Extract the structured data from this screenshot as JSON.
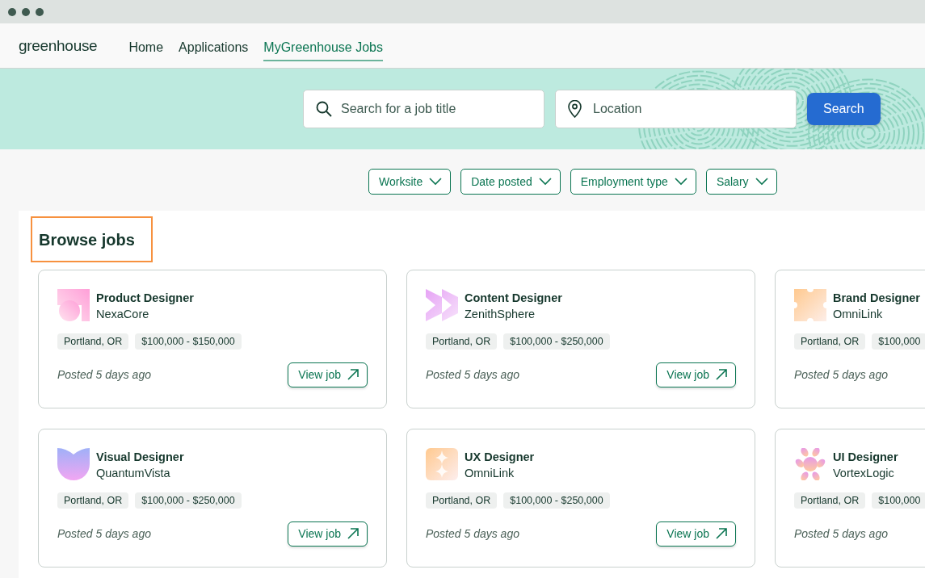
{
  "brand": "greenhouse",
  "nav": [
    {
      "label": "Home",
      "selected": false
    },
    {
      "label": "Applications",
      "selected": false
    },
    {
      "label": "MyGreenhouse Jobs",
      "selected": true
    }
  ],
  "search": {
    "job_placeholder": "Search for a job title",
    "location_placeholder": "Location",
    "button": "Search"
  },
  "filters": [
    "Worksite",
    "Date posted",
    "Employment type",
    "Salary"
  ],
  "section": {
    "title": "Browse jobs",
    "highlighted": true
  },
  "jobs": [
    {
      "kind": "square-circle",
      "title": "Product Designer",
      "company": "NexaCore",
      "tags": [
        "Portland, OR",
        "$100,000 - $150,000"
      ],
      "posted": "Posted 5 days ago",
      "button": "View job"
    },
    {
      "kind": "chevrons",
      "title": "Content Designer",
      "company": "ZenithSphere",
      "tags": [
        "Portland, OR",
        "$100,000 - $250,000"
      ],
      "posted": "Posted 5 days ago",
      "button": "View job"
    },
    {
      "kind": "quarters",
      "title": "Brand Designer",
      "company": "OmniLink",
      "tags": [
        "Portland, OR",
        "$100,000"
      ],
      "posted": "Posted 5 days ago"
    },
    {
      "kind": "tulip",
      "title": "Visual Designer",
      "company": "QuantumVista",
      "tags": [
        "Portland, OR",
        "$100,000 - $250,000"
      ],
      "posted": "Posted 5 days ago",
      "button": "View job"
    },
    {
      "kind": "sparkles",
      "title": "UX Designer",
      "company": "OmniLink",
      "tags": [
        "Portland, OR",
        "$100,000 - $250,000"
      ],
      "posted": "Posted 5 days ago",
      "button": "View job"
    },
    {
      "kind": "flower",
      "title": "UI Designer",
      "company": "VortexLogic",
      "tags": [
        "Portland, OR",
        "$100,000"
      ],
      "posted": "Posted 5 days ago"
    }
  ]
}
